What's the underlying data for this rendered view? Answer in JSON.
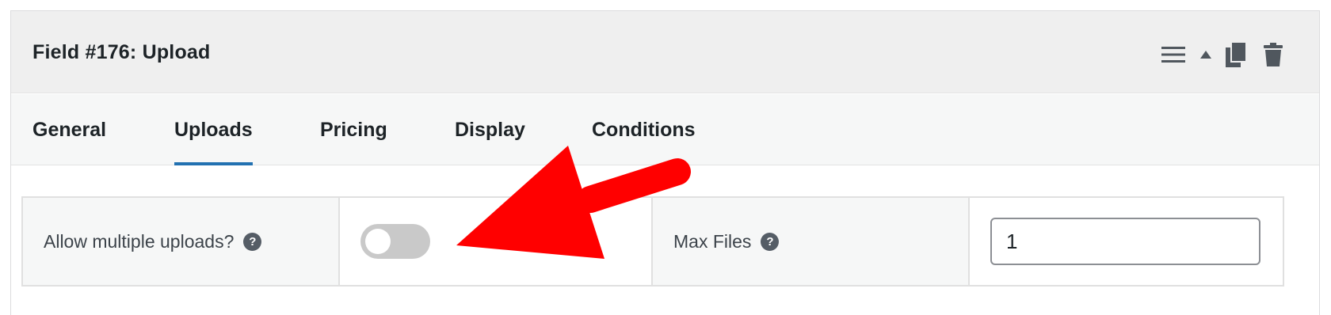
{
  "header": {
    "title": "Field #176: Upload",
    "icons": [
      "menu-icon",
      "caret-up-icon",
      "duplicate-icon",
      "trash-icon"
    ]
  },
  "tabs": [
    {
      "label": "General",
      "active": false
    },
    {
      "label": "Uploads",
      "active": true
    },
    {
      "label": "Pricing",
      "active": false
    },
    {
      "label": "Display",
      "active": false
    },
    {
      "label": "Conditions",
      "active": false
    }
  ],
  "settings": {
    "multiple_uploads": {
      "label": "Allow multiple uploads?",
      "help": "?",
      "enabled": false
    },
    "max_files": {
      "label": "Max Files",
      "help": "?",
      "value": "1"
    }
  },
  "colors": {
    "accent": "#2271b1",
    "annotation_arrow": "#ff0000",
    "toggle_off": "#c9c9c9"
  }
}
